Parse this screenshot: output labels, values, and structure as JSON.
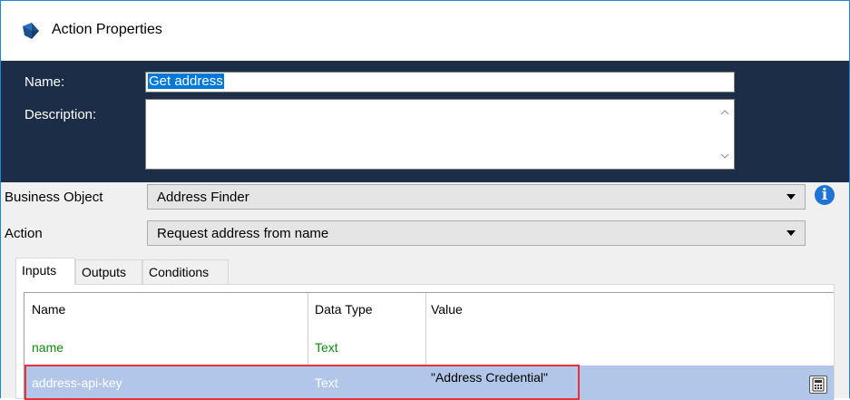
{
  "window": {
    "title": "Action Properties"
  },
  "header": {
    "name_label": "Name:",
    "name_value": "Get address",
    "description_label": "Description:",
    "description_value": ""
  },
  "fields": {
    "business_object_label": "Business Object",
    "business_object_value": "Address Finder",
    "action_label": "Action",
    "action_value": "Request address from name"
  },
  "tabs": [
    {
      "label": "Inputs",
      "active": true
    },
    {
      "label": "Outputs",
      "active": false
    },
    {
      "label": "Conditions",
      "active": false
    }
  ],
  "grid": {
    "columns": [
      "Name",
      "Data Type",
      "Value"
    ],
    "rows": [
      {
        "name": "name",
        "data_type": "Text",
        "value": "",
        "selected": false
      },
      {
        "name": "address-api-key",
        "data_type": "Text",
        "value": "\"Address Credential\"",
        "selected": true
      }
    ]
  },
  "colors": {
    "header_bg": "#1b2d47",
    "selection_bg": "#b1c6e8",
    "highlight_border": "#e8313a",
    "input_name_color": "#118a11",
    "info_icon": "#1e73d4"
  },
  "icons": [
    "blue-prism-logo-icon",
    "info-icon",
    "chevron-up-icon",
    "chevron-down-icon",
    "dropdown-arrow-icon",
    "expression-editor-icon"
  ]
}
